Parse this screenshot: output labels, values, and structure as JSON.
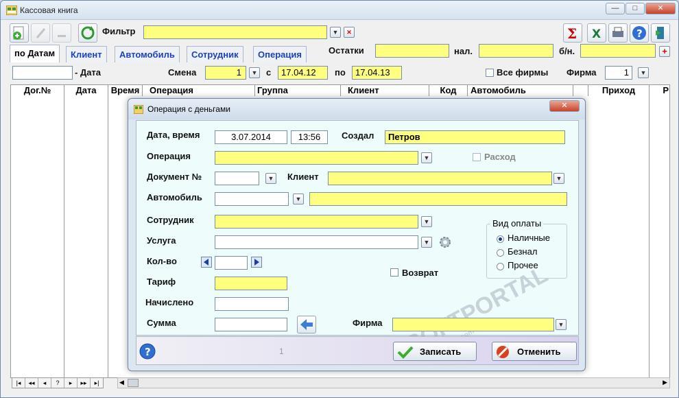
{
  "window": {
    "title": "Кассовая книга"
  },
  "toolbar": {
    "filter_label": "Фильтр"
  },
  "tabs": [
    "по Датам",
    "Клиент",
    "Автомобиль",
    "Сотрудник",
    "Операция"
  ],
  "balances": {
    "label": "Остатки",
    "cash_label": "нал.",
    "noncash_label": "б/н."
  },
  "filterbar": {
    "date_label": "- Дата",
    "shift_label": "Смена",
    "shift_value": "1",
    "from_label": "с",
    "from_value": "17.04.12",
    "to_label": "по",
    "to_value": "17.04.13",
    "all_firms_label": "Все фирмы",
    "firm_label": "Фирма",
    "firm_value": "1"
  },
  "grid": {
    "columns": [
      "Дог.№",
      "Дата",
      "Время",
      "Операция",
      "Группа",
      "Клиент",
      "Код",
      "Автомобиль",
      "Приход",
      "Р"
    ]
  },
  "nav": [
    "|◂",
    "◂◂",
    "◂",
    "?",
    "▸",
    "▸▸",
    "▸|"
  ],
  "dialog": {
    "title": "Операция с деньгами",
    "datetime_label": "Дата, время",
    "date_value": "3.07.2014",
    "time_value": "13:56",
    "created_label": "Создал",
    "created_value": "Петров",
    "operation_label": "Операция",
    "expense_label": "Расход",
    "document_label": "Документ №",
    "client_label": "Клиент",
    "car_label": "Автомобиль",
    "employee_label": "Сотрудник",
    "service_label": "Услуга",
    "qty_label": "Кол-во",
    "return_label": "Возврат",
    "tariff_label": "Тариф",
    "accrued_label": "Начислено",
    "sum_label": "Сумма",
    "firm_label": "Фирма",
    "payment_group_label": "Вид оплаты",
    "payment_options": [
      "Наличные",
      "Безнал",
      "Прочее"
    ],
    "payment_selected": "Наличные",
    "save_label": "Записать",
    "cancel_label": "Отменить",
    "footer_counter": "1"
  },
  "watermark": {
    "text": "SOFTPORTAL",
    "url": "www.softportal.com"
  }
}
